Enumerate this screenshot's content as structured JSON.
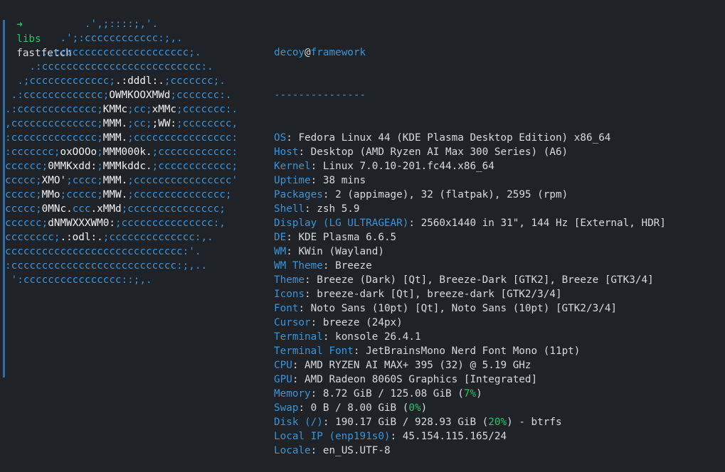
{
  "prompt": {
    "arrow": "➜",
    "dir": "libs",
    "command": "fastfetch"
  },
  "logo_lines": [
    [
      {
        "c": "b",
        "t": "             .',;::::;,'."
      }
    ],
    [
      {
        "c": "b",
        "t": "         .';:cccccccccccc:;,."
      }
    ],
    [
      {
        "c": "b",
        "t": "      .;cccccccccccccccccccccc;."
      }
    ],
    [
      {
        "c": "b",
        "t": "    .:cccccccccccccccccccccccccc:."
      }
    ],
    [
      {
        "c": "b",
        "t": "  .;ccccccccccccc;"
      },
      {
        "c": "w",
        "t": ".:dddl:."
      },
      {
        "c": "b",
        "t": ";ccccccc;."
      }
    ],
    [
      {
        "c": "b",
        "t": " .:ccccccccccccc;"
      },
      {
        "c": "w",
        "t": "OWMKOOXMWd"
      },
      {
        "c": "b",
        "t": ";ccccccc:."
      }
    ],
    [
      {
        "c": "b",
        "t": ".:ccccccccccccc;"
      },
      {
        "c": "w",
        "t": "KMMc"
      },
      {
        "c": "b",
        "t": ";cc;"
      },
      {
        "c": "w",
        "t": "xMMc"
      },
      {
        "c": "b",
        "t": ";ccccccc:."
      }
    ],
    [
      {
        "c": "b",
        "t": ",cccccccccccccc;"
      },
      {
        "c": "w",
        "t": "MMM."
      },
      {
        "c": "b",
        "t": ";cc;"
      },
      {
        "c": "w",
        "t": ";WW:"
      },
      {
        "c": "b",
        "t": ";cccccccc,"
      }
    ],
    [
      {
        "c": "b",
        "t": ":cccccccccccccc;"
      },
      {
        "c": "w",
        "t": "MMM."
      },
      {
        "c": "b",
        "t": ";cccccccccccccccc:"
      }
    ],
    [
      {
        "c": "b",
        "t": ":ccccccc;"
      },
      {
        "c": "w",
        "t": "oxOOOo"
      },
      {
        "c": "b",
        "t": ";"
      },
      {
        "c": "w",
        "t": "MMM000k."
      },
      {
        "c": "b",
        "t": ";cccccccccccc:"
      }
    ],
    [
      {
        "c": "b",
        "t": "cccccc;"
      },
      {
        "c": "w",
        "t": "0MMKxdd:"
      },
      {
        "c": "b",
        "t": ";"
      },
      {
        "c": "w",
        "t": "MMMkddc."
      },
      {
        "c": "b",
        "t": ";cccccccccccc;"
      }
    ],
    [
      {
        "c": "b",
        "t": "ccccc;"
      },
      {
        "c": "w",
        "t": "XMO'"
      },
      {
        "c": "b",
        "t": ";cccc;"
      },
      {
        "c": "w",
        "t": "MMM."
      },
      {
        "c": "b",
        "t": ";cccccccccccccccc'"
      }
    ],
    [
      {
        "c": "b",
        "t": "ccccc;"
      },
      {
        "c": "w",
        "t": "MMo"
      },
      {
        "c": "b",
        "t": ";ccccc;"
      },
      {
        "c": "w",
        "t": "MMW."
      },
      {
        "c": "b",
        "t": ";ccccccccccccccc;"
      }
    ],
    [
      {
        "c": "b",
        "t": "ccccc;"
      },
      {
        "c": "w",
        "t": "0MNc."
      },
      {
        "c": "b",
        "t": "ccc"
      },
      {
        "c": "w",
        "t": ".xMMd"
      },
      {
        "c": "b",
        "t": ";ccccccccccccccc;"
      }
    ],
    [
      {
        "c": "b",
        "t": "cccccc;"
      },
      {
        "c": "w",
        "t": "dNMWXXXWM0:"
      },
      {
        "c": "b",
        "t": ";ccccccccccccccc:,"
      }
    ],
    [
      {
        "c": "b",
        "t": "cccccccc;"
      },
      {
        "c": "w",
        "t": ".:odl:."
      },
      {
        "c": "b",
        "t": ";cccccccccccccc:,."
      }
    ],
    [
      {
        "c": "b",
        "t": "ccccccccccccccccccccccccccccc:'."
      }
    ],
    [
      {
        "c": "b",
        "t": ":ccccccccccccccccccccccccccc:;,.."
      }
    ],
    [
      {
        "c": "b",
        "t": " ':cccccccccccccccc::;,."
      }
    ]
  ],
  "header": {
    "user": "decoy",
    "at": "@",
    "host": "framework",
    "separator": "---------------"
  },
  "info": [
    {
      "key": "OS",
      "parts": [
        {
          "t": "Fedora Linux 44 (KDE Plasma Desktop Edition) x86_64"
        }
      ]
    },
    {
      "key": "Host",
      "parts": [
        {
          "t": "Desktop (AMD Ryzen AI Max 300 Series) (A6)"
        }
      ]
    },
    {
      "key": "Kernel",
      "parts": [
        {
          "t": "Linux 7.0.10-201.fc44.x86_64"
        }
      ]
    },
    {
      "key": "Uptime",
      "parts": [
        {
          "t": "38 mins"
        }
      ]
    },
    {
      "key": "Packages",
      "parts": [
        {
          "t": "2 (appimage), 32 (flatpak), 2595 (rpm)"
        }
      ]
    },
    {
      "key": "Shell",
      "parts": [
        {
          "t": "zsh 5.9"
        }
      ]
    },
    {
      "key": "Display (LG ULTRAGEAR)",
      "parts": [
        {
          "t": "2560x1440 in 31\", 144 Hz [External, HDR]"
        }
      ]
    },
    {
      "key": "DE",
      "parts": [
        {
          "t": "KDE Plasma 6.6.5"
        }
      ]
    },
    {
      "key": "WM",
      "parts": [
        {
          "t": "KWin (Wayland)"
        }
      ]
    },
    {
      "key": "WM Theme",
      "parts": [
        {
          "t": "Breeze"
        }
      ]
    },
    {
      "key": "Theme",
      "parts": [
        {
          "t": "Breeze (Dark) [Qt], Breeze-Dark [GTK2], Breeze [GTK3/4]"
        }
      ]
    },
    {
      "key": "Icons",
      "parts": [
        {
          "t": "breeze-dark [Qt], breeze-dark [GTK2/3/4]"
        }
      ]
    },
    {
      "key": "Font",
      "parts": [
        {
          "t": "Noto Sans (10pt) [Qt], Noto Sans (10pt) [GTK2/3/4]"
        }
      ]
    },
    {
      "key": "Cursor",
      "parts": [
        {
          "t": "breeze (24px)"
        }
      ]
    },
    {
      "key": "Terminal",
      "parts": [
        {
          "t": "konsole 26.4.1"
        }
      ]
    },
    {
      "key": "Terminal Font",
      "parts": [
        {
          "t": "JetBrainsMono Nerd Font Mono (11pt)"
        }
      ]
    },
    {
      "key": "CPU",
      "parts": [
        {
          "t": "AMD RYZEN AI MAX+ 395 (32) @ 5.19 GHz"
        }
      ]
    },
    {
      "key": "GPU",
      "parts": [
        {
          "t": "AMD Radeon 8060S Graphics [Integrated]"
        }
      ]
    },
    {
      "key": "Memory",
      "parts": [
        {
          "t": "8.72 GiB / 125.08 GiB ("
        },
        {
          "t": "7%",
          "green": true
        },
        {
          "t": ")"
        }
      ]
    },
    {
      "key": "Swap",
      "parts": [
        {
          "t": "0 B / 8.00 GiB ("
        },
        {
          "t": "0%",
          "green": true
        },
        {
          "t": ")"
        }
      ]
    },
    {
      "key": "Disk (/)",
      "parts": [
        {
          "t": "190.17 GiB / 928.93 GiB ("
        },
        {
          "t": "20%",
          "green": true
        },
        {
          "t": ") - btrfs"
        }
      ]
    },
    {
      "key": "Local IP (enp191s0)",
      "parts": [
        {
          "t": "45.154.115.165/24"
        }
      ]
    },
    {
      "key": "Locale",
      "parts": [
        {
          "t": "en_US.UTF-8"
        }
      ]
    }
  ],
  "colors": {
    "background": "#1f2226",
    "key_blue": "#3b94da",
    "text": "#d7dade",
    "green": "#27c46a",
    "logo_white": "#f1f3f5"
  }
}
